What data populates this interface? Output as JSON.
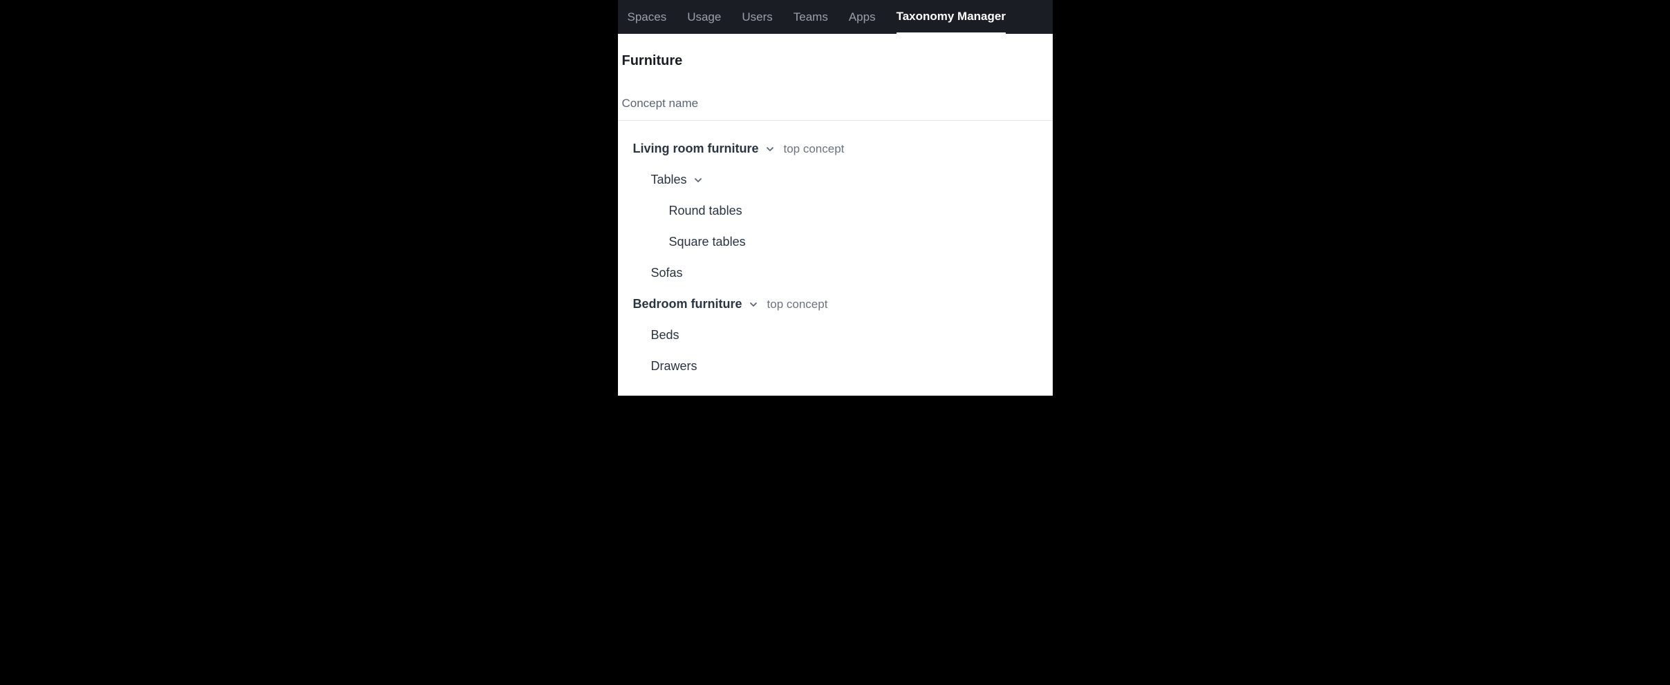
{
  "nav": {
    "items": [
      {
        "label": "Spaces",
        "active": false
      },
      {
        "label": "Usage",
        "active": false
      },
      {
        "label": "Users",
        "active": false
      },
      {
        "label": "Teams",
        "active": false
      },
      {
        "label": "Apps",
        "active": false
      },
      {
        "label": "Taxonomy Manager",
        "active": true
      }
    ]
  },
  "page": {
    "title": "Furniture"
  },
  "search": {
    "placeholder": "Concept name"
  },
  "badges": {
    "top_concept": "top concept"
  },
  "tree": {
    "nodes": [
      {
        "label": "Living room furniture",
        "top": true,
        "expanded": true,
        "children": [
          {
            "label": "Tables",
            "expanded": true,
            "children": [
              {
                "label": "Round tables"
              },
              {
                "label": "Square tables"
              }
            ]
          },
          {
            "label": "Sofas"
          }
        ]
      },
      {
        "label": "Bedroom furniture",
        "top": true,
        "expanded": true,
        "children": [
          {
            "label": "Beds"
          },
          {
            "label": "Drawers"
          }
        ]
      }
    ]
  }
}
